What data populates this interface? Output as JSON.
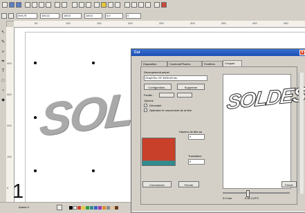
{
  "toolbar": {
    "fields": [
      "209,75",
      "100,11",
      "100,0",
      "100,0",
      "0,0",
      "0"
    ]
  },
  "rulers": {
    "horizontal_ticks": [
      "50",
      "100",
      "150",
      "200",
      "250",
      "300",
      "350",
      "400",
      "450"
    ],
    "vertical_ticks": [
      "400",
      "300",
      "200",
      "100",
      "0"
    ]
  },
  "artwork": {
    "text": "SOLDES"
  },
  "dialog": {
    "title": "Cut",
    "tabs": [
      "Disposition",
      "Couleurs/Plumes",
      "Fenêtres",
      "Croquer"
    ],
    "section_label": "Découpement actuel",
    "select_value": "GraphTec CE 3000-60 etc",
    "config_button": "Configuration...",
    "remove_button": "Supprimer",
    "field_labels": [
      "Feuille :",
      "Options"
    ],
    "check1": "Déroulant",
    "check2": "Optimiser le mouvement de la tête",
    "hauteur_label": "Hauteur de tête au",
    "hauteur_value": "0",
    "translation_label": "Translation",
    "translation_value": "0",
    "preview_text": "SOLDES",
    "zoom_left": "3.0 mm",
    "zoom_right": "0.98 CUTS",
    "apply_button": "Commencer",
    "print_button": "Fermer",
    "close_button": "Fermé"
  },
  "bottom": {
    "page_label": "Autres 0"
  },
  "step_number": "1",
  "colors": {
    "titlebar": "#1b4fb2",
    "swatch": "#c8402a",
    "band": "#2f8c8e"
  }
}
